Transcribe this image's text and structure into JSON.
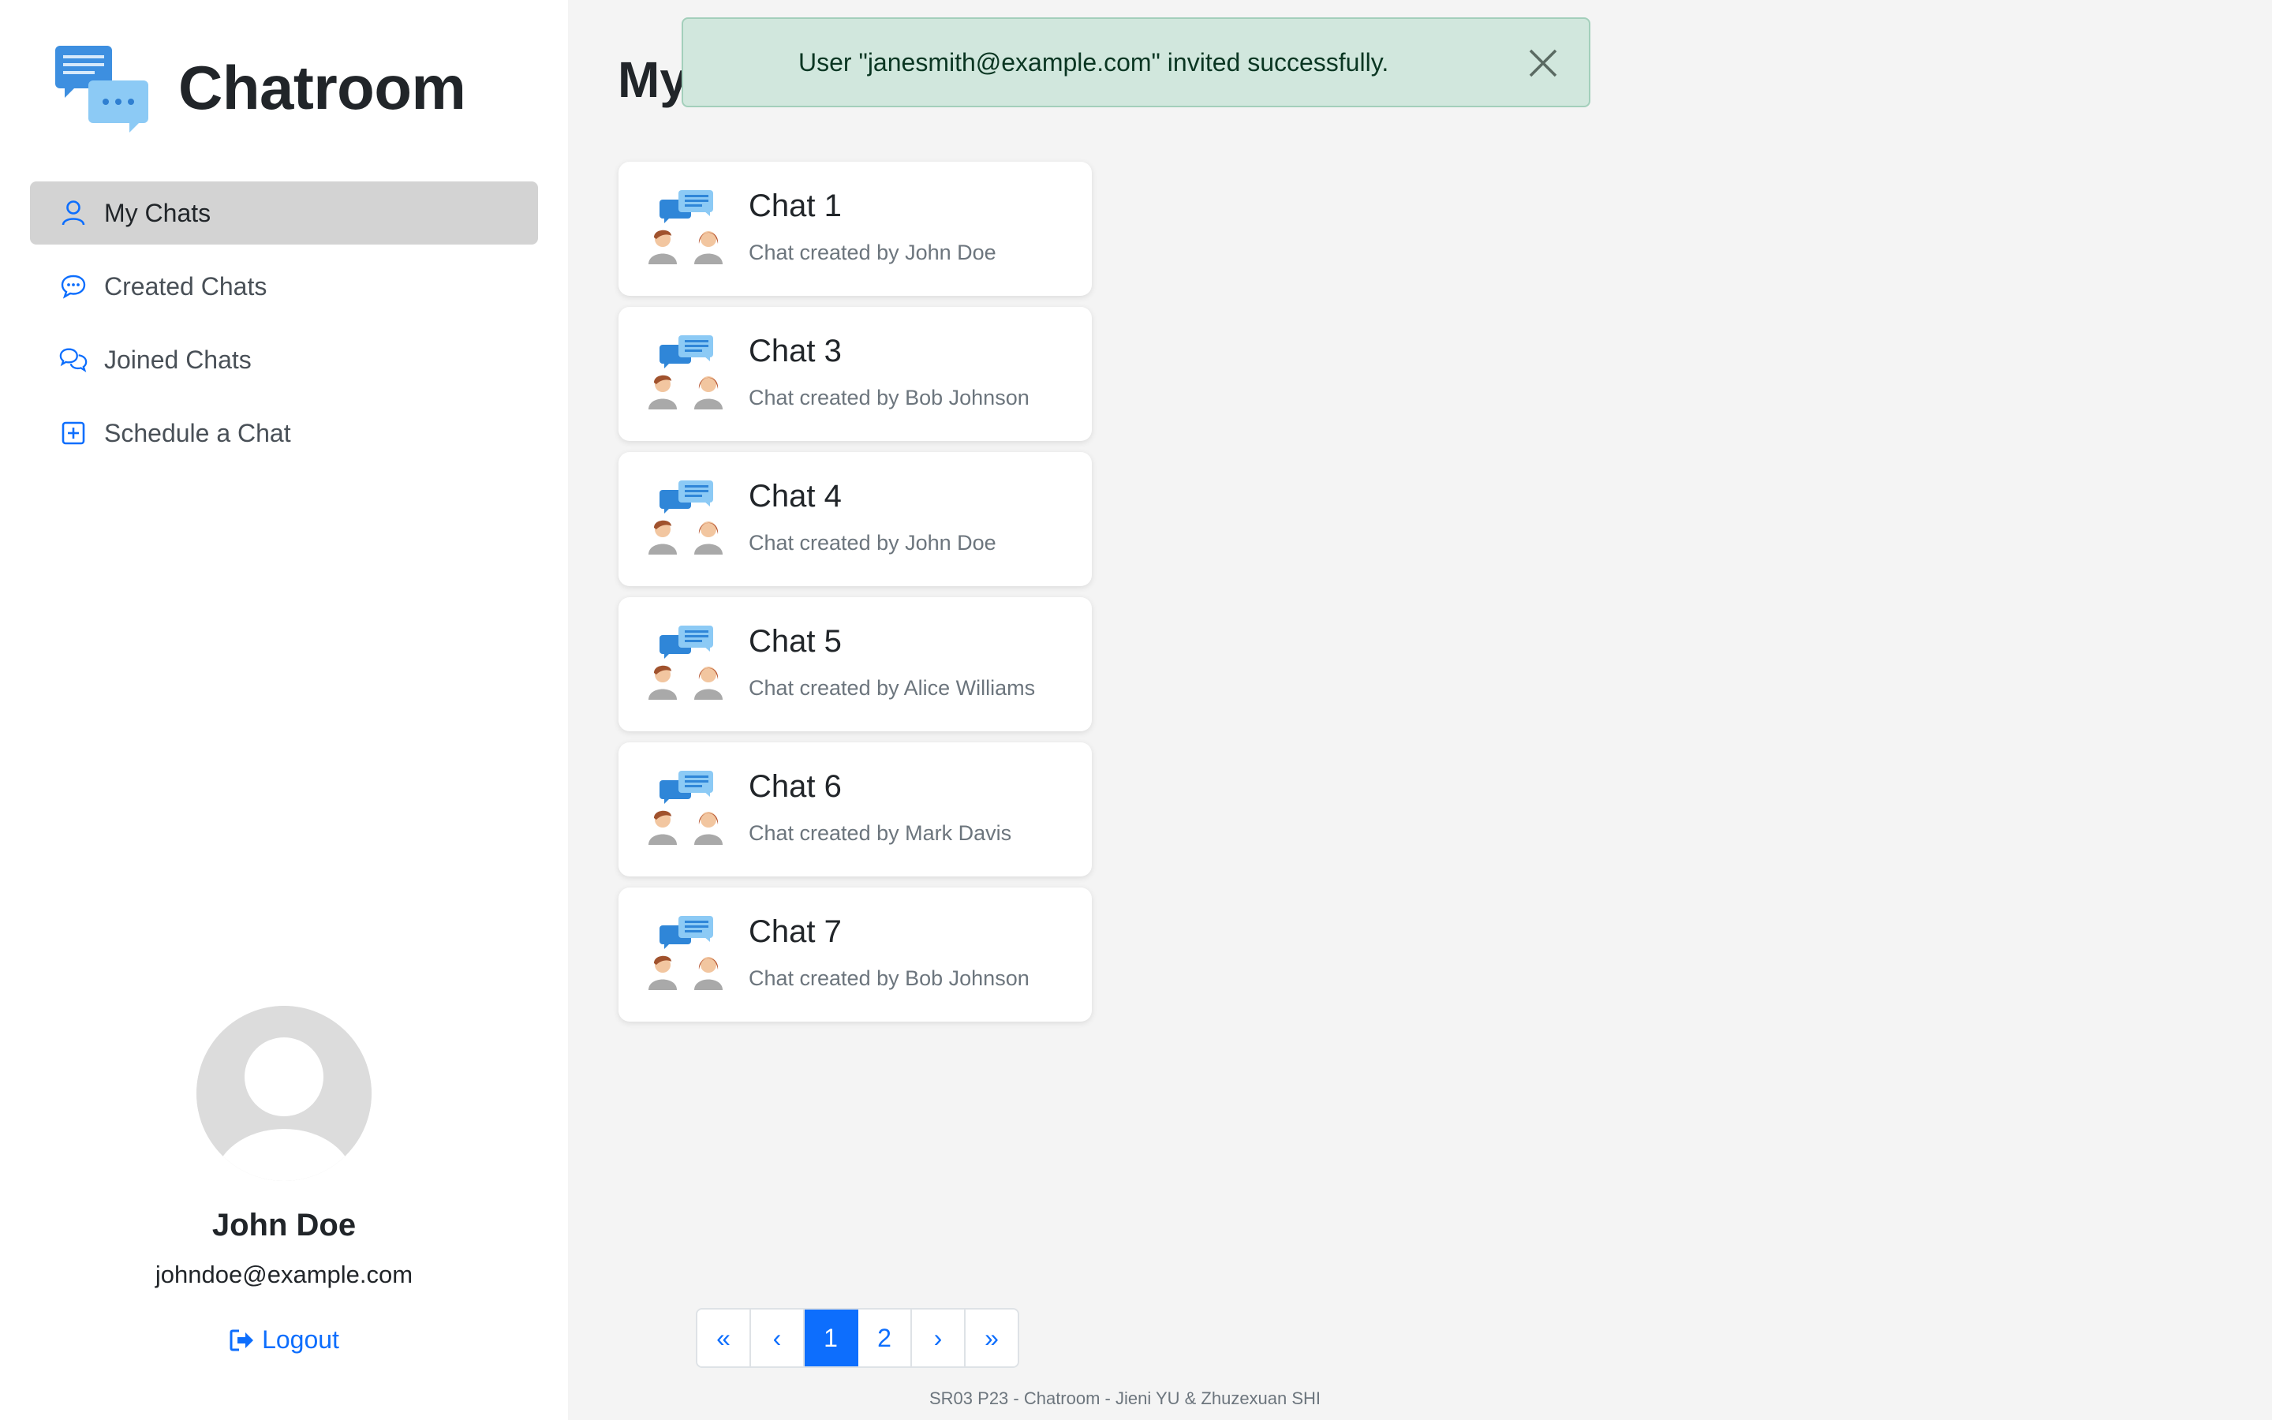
{
  "app": {
    "title": "Chatroom"
  },
  "nav": {
    "items": [
      {
        "label": "My Chats",
        "icon": "person-icon",
        "active": true
      },
      {
        "label": "Created Chats",
        "icon": "chat-dots-icon",
        "active": false
      },
      {
        "label": "Joined Chats",
        "icon": "chats-icon",
        "active": false
      },
      {
        "label": "Schedule a Chat",
        "icon": "plus-square-icon",
        "active": false
      }
    ]
  },
  "user": {
    "name": "John Doe",
    "email": "johndoe@example.com",
    "logout_label": "Logout"
  },
  "main": {
    "title": "My Chats"
  },
  "alert": {
    "message": "User \"janesmith@example.com\" invited successfully."
  },
  "chats": [
    {
      "title": "Chat 1",
      "subtitle": "Chat created by John Doe"
    },
    {
      "title": "Chat 3",
      "subtitle": "Chat created by Bob Johnson"
    },
    {
      "title": "Chat 4",
      "subtitle": "Chat created by John Doe"
    },
    {
      "title": "Chat 5",
      "subtitle": "Chat created by Alice Williams"
    },
    {
      "title": "Chat 6",
      "subtitle": "Chat created by Mark Davis"
    },
    {
      "title": "Chat 7",
      "subtitle": "Chat created by Bob Johnson"
    }
  ],
  "pagination": {
    "first": "«",
    "prev": "‹",
    "pages": [
      "1",
      "2"
    ],
    "current": "1",
    "next": "›",
    "last": "»"
  },
  "footer": {
    "text": "SR03 P23 - Chatroom - Jieni YU & Zhuzexuan SHI"
  },
  "colors": {
    "accent": "#0d6efd",
    "alert_bg": "#d1e7dd",
    "active_nav": "#d3d3d3"
  }
}
